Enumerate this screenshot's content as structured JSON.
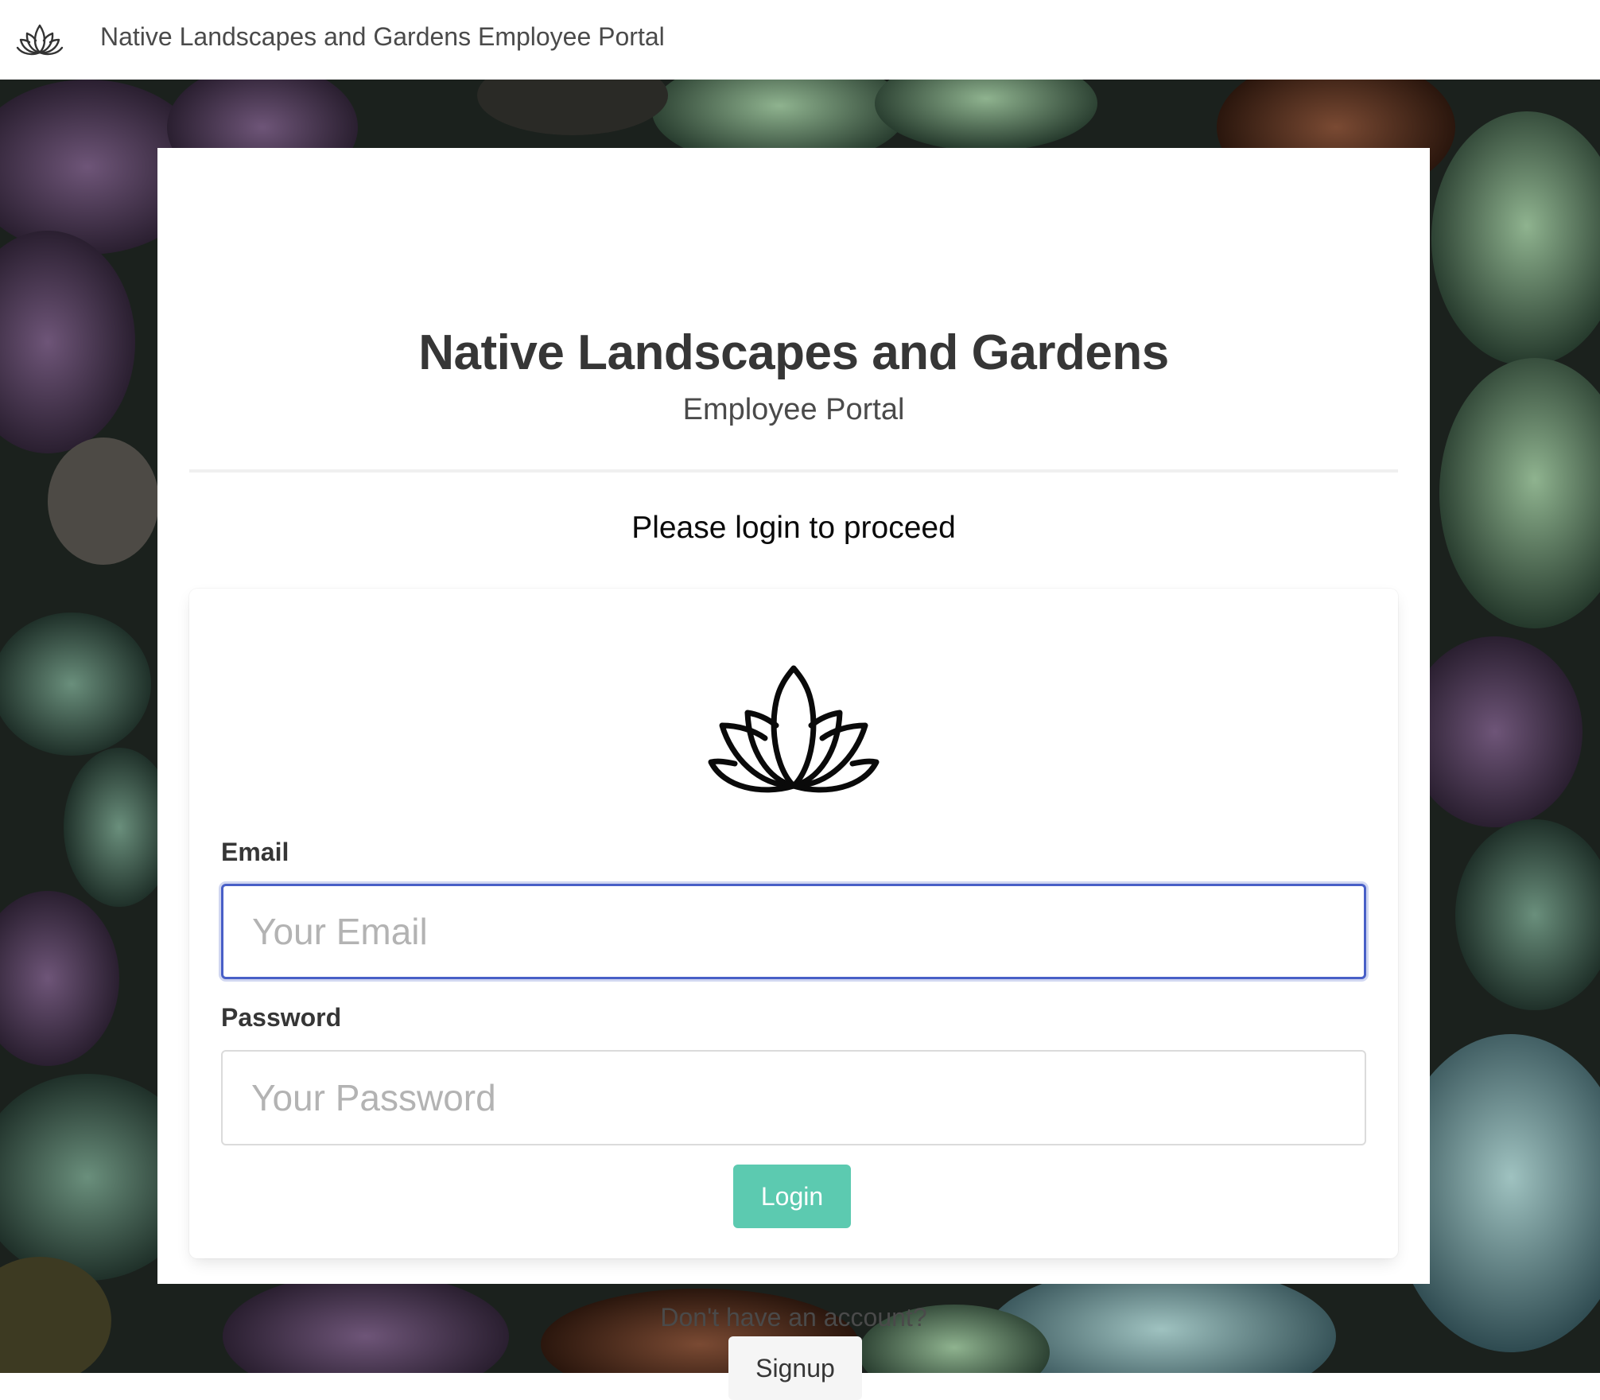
{
  "navbar": {
    "brand_icon": "lotus-icon",
    "brand_title": "Native Landscapes and Gardens Employee Portal"
  },
  "hero": {
    "title": "Native Landscapes and Gardens",
    "subtitle": "Employee Portal"
  },
  "prompt": "Please login to proceed",
  "login_form": {
    "logo_icon": "lotus-icon",
    "email": {
      "label": "Email",
      "placeholder": "Your Email",
      "value": "",
      "focused": true
    },
    "password": {
      "label": "Password",
      "placeholder": "Your Password",
      "value": ""
    },
    "login_label": "Login"
  },
  "signup": {
    "question": "Don't have an account?",
    "button_label": "Signup"
  },
  "colors": {
    "primary_button": "#5ccab0",
    "focus_border": "#485fc7",
    "title_text": "#363636",
    "secondary_button": "#f5f5f5"
  },
  "background_image": "succulent-plants-photo"
}
